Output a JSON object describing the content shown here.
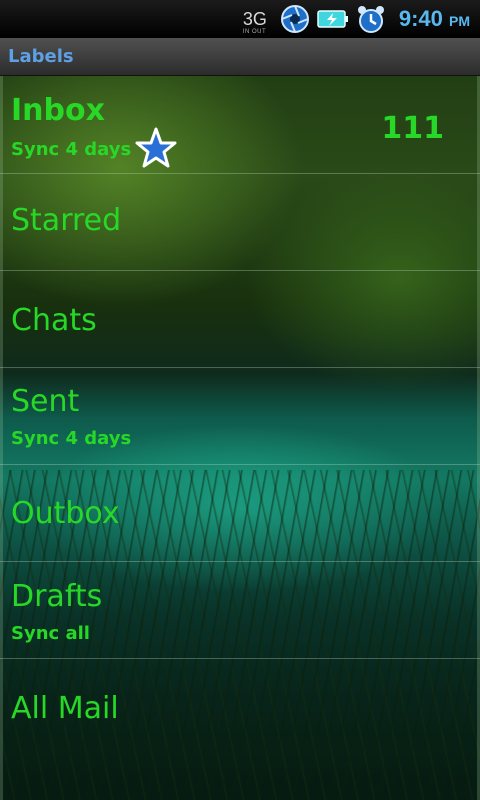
{
  "status_bar": {
    "network": "3G",
    "network_sub": "IN OUT",
    "icons": [
      "aperture-icon",
      "battery-charging-icon",
      "alarm-clock-icon"
    ],
    "time": "9:40",
    "ampm": "PM"
  },
  "title_bar": {
    "title": "Labels"
  },
  "labels": [
    {
      "name": "Inbox",
      "sync": "Sync 4 days",
      "count": "111"
    },
    {
      "name": "Starred",
      "icon": "star-icon"
    },
    {
      "name": "Chats"
    },
    {
      "name": "Sent",
      "sync": "Sync 4 days"
    },
    {
      "name": "Outbox"
    },
    {
      "name": "Drafts",
      "sync": "Sync all"
    },
    {
      "name": "All Mail"
    }
  ],
  "colors": {
    "label_text": "#27d827",
    "title_text": "#5ea0e6",
    "time_text": "#58b8f0",
    "star_fill": "#2a6fd6"
  }
}
